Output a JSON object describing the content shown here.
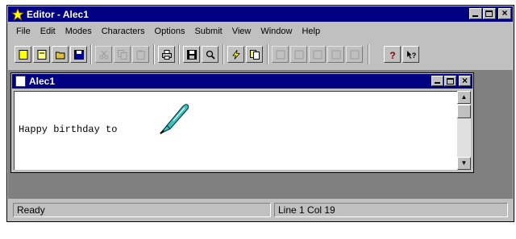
{
  "window": {
    "title": "Editor - Alec1",
    "title_color": "#000080"
  },
  "menu": [
    "File",
    "Edit",
    "Modes",
    "Characters",
    "Options",
    "Submit",
    "View",
    "Window",
    "Help"
  ],
  "toolbar": {
    "buttons": [
      {
        "name": "new-doc-icon",
        "enabled": true
      },
      {
        "name": "new-template-icon",
        "enabled": true
      },
      {
        "name": "open-folder-icon",
        "enabled": true
      },
      {
        "name": "save-disk-icon",
        "enabled": true
      },
      {
        "name": "cut-icon",
        "enabled": false
      },
      {
        "name": "copy-icon",
        "enabled": false
      },
      {
        "name": "paste-icon",
        "enabled": false
      },
      {
        "name": "print-icon",
        "enabled": true
      },
      {
        "name": "save-as-icon",
        "enabled": true
      },
      {
        "name": "find-icon",
        "enabled": true
      },
      {
        "name": "lightning-icon",
        "enabled": true
      },
      {
        "name": "pages-icon",
        "enabled": true
      },
      {
        "name": "tool-1-icon",
        "enabled": false
      },
      {
        "name": "tool-2-icon",
        "enabled": false
      },
      {
        "name": "tool-3-icon",
        "enabled": false
      },
      {
        "name": "tool-4-icon",
        "enabled": false
      },
      {
        "name": "tool-5-icon",
        "enabled": false
      },
      {
        "name": "help-icon",
        "enabled": true
      },
      {
        "name": "context-help-icon",
        "enabled": true
      }
    ]
  },
  "document": {
    "title": "Alec1",
    "content": "Happy birthday to ",
    "inline_image_icon": "quill-pen-icon"
  },
  "status": {
    "message": "Ready",
    "position": "Line 1  Col 19"
  }
}
